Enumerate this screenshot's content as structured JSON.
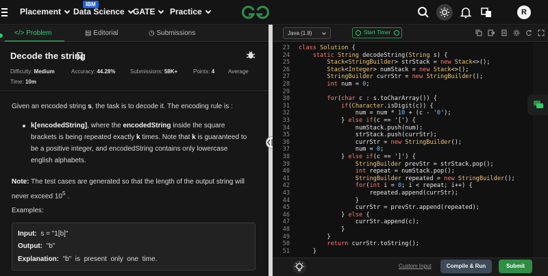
{
  "nav": {
    "items": [
      {
        "label": "Placement"
      },
      {
        "label": "Data Science",
        "badge": "IBM"
      },
      {
        "label": "GATE"
      },
      {
        "label": "Practice"
      }
    ],
    "logo_text": "GfG",
    "avatar_initial": "R",
    "brand_color": "#2f8d46"
  },
  "left_tabs": [
    {
      "label": "Problem",
      "icon": "code-icon"
    },
    {
      "label": "Editorial",
      "icon": "book-icon"
    },
    {
      "label": "Submissions",
      "icon": "clock-icon"
    }
  ],
  "problem": {
    "title": "Decode the string",
    "difficulty_label": "Difficulty:",
    "difficulty": "Medium",
    "accuracy_label": "Accuracy:",
    "accuracy": "44.28%",
    "submissions_label": "Submissions:",
    "submissions": "58K+",
    "points_label": "Points:",
    "points": "4",
    "average_label": "Average",
    "time_label": "Time:",
    "time": "10m",
    "intro_p1": "Given an encoded string ",
    "intro_s": "s",
    "intro_p2": ", the task is to decode it. The encoding rule is :",
    "rule_b1": "k[encodedString]",
    "rule_t1": ", where the ",
    "rule_b2": "encodedString",
    "rule_t2": " inside the square brackets is being repeated exactly ",
    "rule_b3": "k",
    "rule_t3": " times. Note that ",
    "rule_b4": "k",
    "rule_t4": " is guaranteed to be a positive integer, and encodedString contains only lowercase english alphabets.",
    "note_label": "Note:",
    "note_text": " The test cases are generated so that the length of the output string will never exceed 10",
    "note_sup": "5",
    "note_end": " .",
    "examples_heading": "Examples:",
    "example": {
      "input_label": "Input:",
      "input_value": "  s = \"1[b]\"",
      "output_label": "Output:",
      "output_value": "  \"b\"",
      "explanation_label": "Explanation:",
      "explanation_value": "  \"b\"  is  present  only  one  time."
    }
  },
  "editor": {
    "language": "Java (1.8)",
    "timer_label": "Start Timer",
    "toolbar_icons": [
      "copy-icon",
      "export-icon",
      "document-icon",
      "settings-icon",
      "refresh-icon",
      "fullscreen-icon"
    ],
    "lines": [
      {
        "n": "23",
        "code": "class Solution {"
      },
      {
        "n": "24",
        "code": "    static String decodeString(String s) {"
      },
      {
        "n": "25",
        "code": "        Stack<StringBuilder> strStack = new Stack<>();"
      },
      {
        "n": "26",
        "code": "        Stack<Integer> numStack = new Stack<>();"
      },
      {
        "n": "27",
        "code": "        StringBuilder currStr = new StringBuilder();"
      },
      {
        "n": "28",
        "code": "        int num = 0;"
      },
      {
        "n": "29",
        "code": ""
      },
      {
        "n": "30",
        "code": "        for(char c : s.toCharArray()) {"
      },
      {
        "n": "31",
        "code": "            if(Character.isDigit(c)) {"
      },
      {
        "n": "32",
        "code": "                num = num * 10 + (c - '0');"
      },
      {
        "n": "33",
        "code": "            } else if(c == '[') {"
      },
      {
        "n": "34",
        "code": "                numStack.push(num);"
      },
      {
        "n": "35",
        "code": "                strStack.push(currStr);"
      },
      {
        "n": "36",
        "code": "                currStr = new StringBuilder();"
      },
      {
        "n": "37",
        "code": "                num = 0;"
      },
      {
        "n": "38",
        "code": "            } else if(c == ']') {"
      },
      {
        "n": "39",
        "code": "                StringBuilder prevStr = strStack.pop();"
      },
      {
        "n": "40",
        "code": "                int repeat = numStack.pop();"
      },
      {
        "n": "41",
        "code": "                StringBuilder repeated = new StringBuilder();"
      },
      {
        "n": "42",
        "code": "                for(int i = 0; i < repeat; i++) {"
      },
      {
        "n": "43",
        "code": "                    repeated.append(currStr);"
      },
      {
        "n": "44",
        "code": "                }"
      },
      {
        "n": "45",
        "code": "                currStr = prevStr.append(repeated);"
      },
      {
        "n": "46",
        "code": "            } else {"
      },
      {
        "n": "47",
        "code": "                currStr.append(c);"
      },
      {
        "n": "48",
        "code": "            }"
      },
      {
        "n": "49",
        "code": "        }"
      },
      {
        "n": "50",
        "code": "        return currStr.toString();"
      },
      {
        "n": "51",
        "code": "    }"
      }
    ]
  },
  "footer": {
    "custom_input": "Custom Input",
    "compile_run": "Compile & Run",
    "submit": "Submit"
  }
}
